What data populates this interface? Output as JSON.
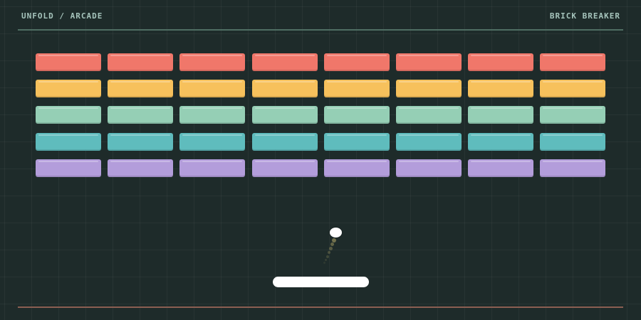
{
  "header": {
    "breadcrumb": "UNFOLD / ARCADE",
    "game_title": "BRICK BREAKER"
  },
  "colors": {
    "background": "#1e2b2a",
    "top_rule": "#4f6e63",
    "bottom_rule": "#8a5e52",
    "paddle": "#ffffff",
    "ball": "#ffffff"
  },
  "bricks": {
    "columns": 8,
    "rows": [
      {
        "color": "#f0776a"
      },
      {
        "color": "#f7c15c"
      },
      {
        "color": "#95cfb5"
      },
      {
        "color": "#5fbcbd"
      },
      {
        "color": "#b39ddb"
      }
    ]
  }
}
